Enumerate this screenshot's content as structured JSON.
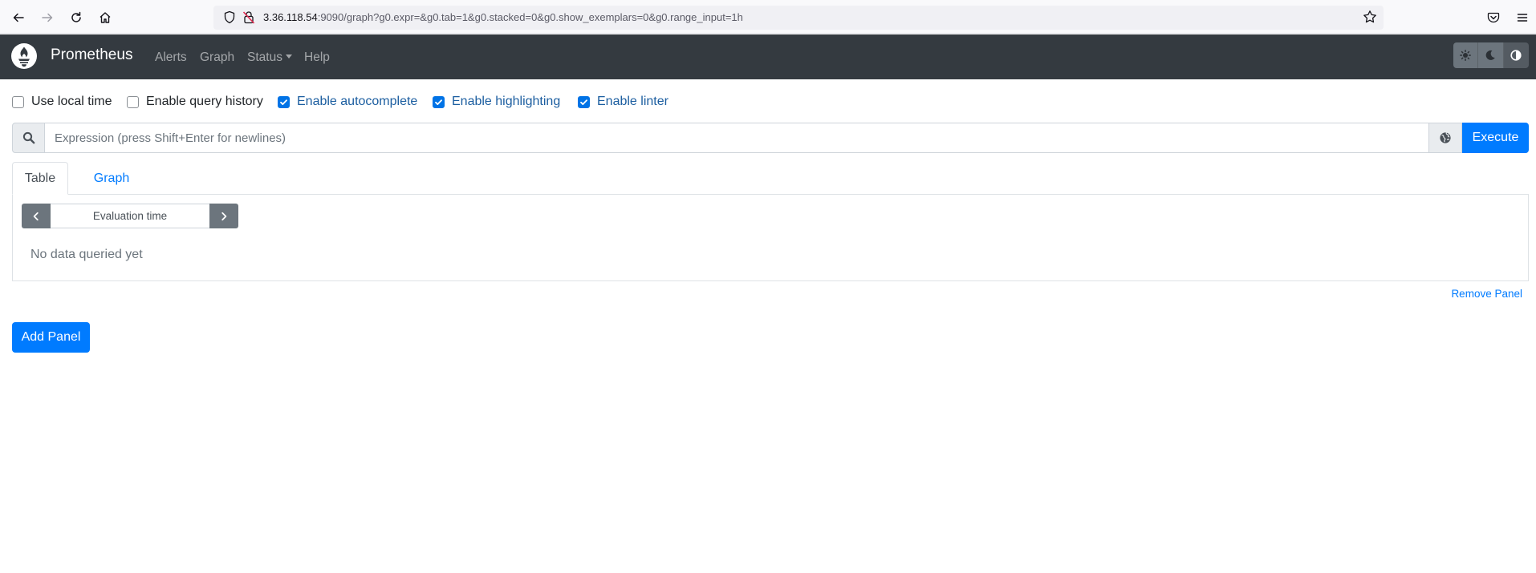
{
  "browser": {
    "url_host": "3.36.118.54",
    "url_rest": ":9090/graph?g0.expr=&g0.tab=1&g0.stacked=0&g0.show_exemplars=0&g0.range_input=1h"
  },
  "navbar": {
    "brand": "Prometheus",
    "links": [
      "Alerts",
      "Graph",
      "Status",
      "Help"
    ],
    "bg_color": "#343a40"
  },
  "options": [
    {
      "label": "Use local time",
      "checked": false
    },
    {
      "label": "Enable query history",
      "checked": false
    },
    {
      "label": "Enable autocomplete",
      "checked": true
    },
    {
      "label": "Enable highlighting",
      "checked": true
    },
    {
      "label": "Enable linter",
      "checked": true
    }
  ],
  "expression": {
    "placeholder": "Expression (press Shift+Enter for newlines)",
    "execute_label": "Execute"
  },
  "panel": {
    "tabs": [
      "Table",
      "Graph"
    ],
    "active_tab": "Table",
    "evaluation_time_placeholder": "Evaluation time",
    "empty_message": "No data queried yet",
    "remove_label": "Remove Panel"
  },
  "add_panel_label": "Add Panel",
  "colors": {
    "primary": "#007bff",
    "checkbox_checked": "#0073e6"
  }
}
